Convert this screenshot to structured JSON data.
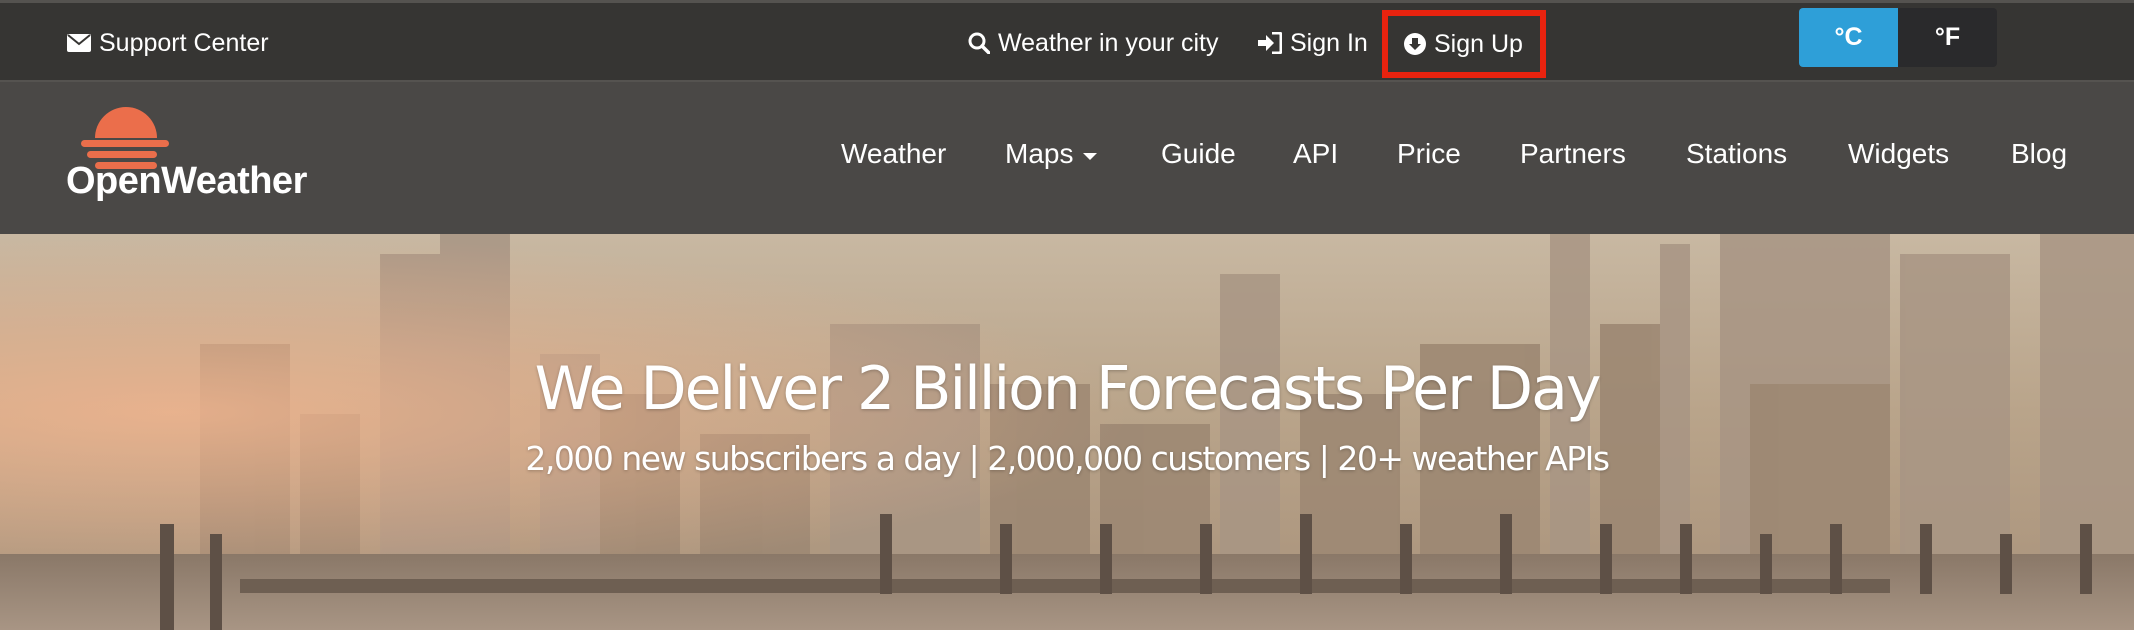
{
  "topbar": {
    "support_label": "Support Center",
    "weather_city_label": "Weather in your city",
    "signin_label": "Sign In",
    "signup_label": "Sign Up",
    "units": {
      "celsius": "°C",
      "fahrenheit": "°F",
      "active": "celsius"
    }
  },
  "brand": {
    "name": "OpenWeather",
    "logo_color": "#eb6e4b"
  },
  "nav": {
    "items": [
      "Weather",
      "Maps",
      "Guide",
      "API",
      "Price",
      "Partners",
      "Stations",
      "Widgets",
      "Blog"
    ]
  },
  "hero": {
    "title": "We Deliver 2 Billion Forecasts Per Day",
    "subtitle": "2,000 new subscribers a day | 2,000,000 customers | 20+ weather APIs"
  },
  "colors": {
    "highlight_border": "#e8230f",
    "unit_active": "#2e9fd8",
    "topbar_bg": "#363533",
    "navbar_bg": "#4a4846"
  }
}
